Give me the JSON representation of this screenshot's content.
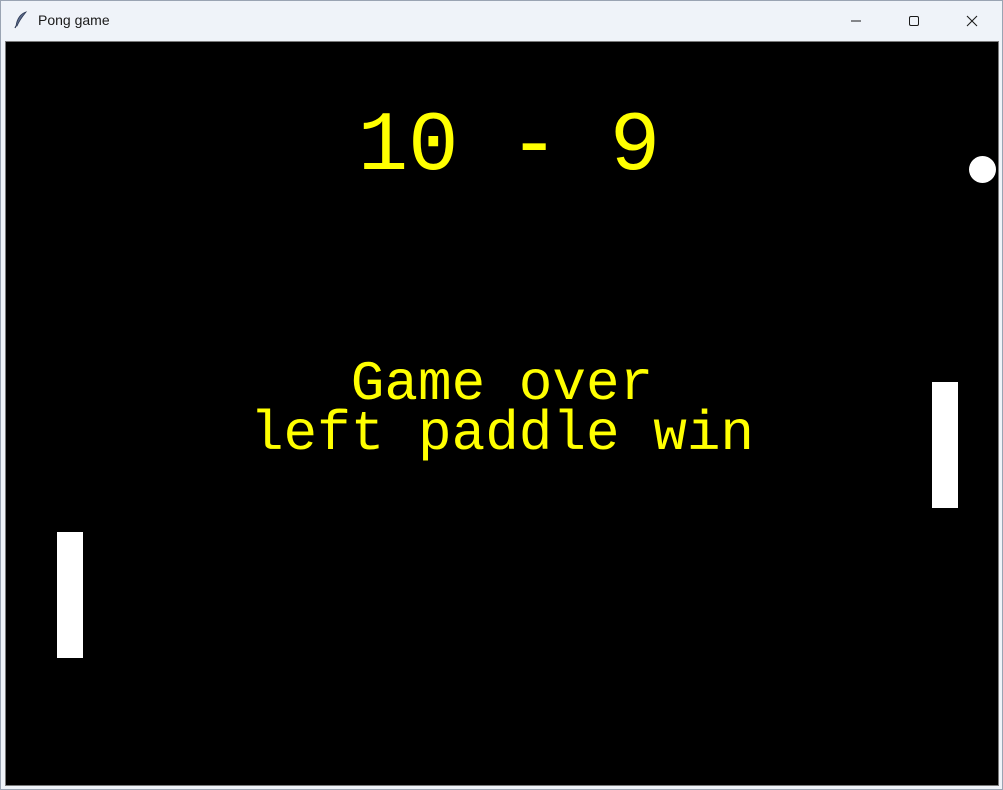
{
  "window": {
    "title": "Pong game",
    "icon": "feather-icon",
    "controls": [
      "minimize-icon",
      "maximize-icon",
      "close-icon"
    ]
  },
  "game": {
    "score_text": "10 - 9",
    "left_score": 10,
    "right_score": 9,
    "message_line1": "Game over",
    "message_line2": "left paddle win",
    "colors": {
      "background": "#000000",
      "text": "#ffff00",
      "paddle": "#ffffff",
      "ball": "#ffffff"
    }
  }
}
